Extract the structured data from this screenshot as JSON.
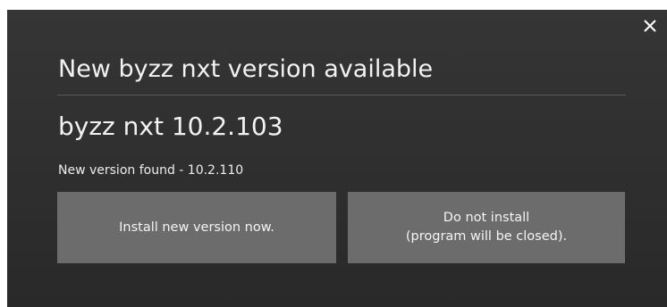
{
  "dialog": {
    "title": "New byzz nxt version available",
    "current_version": "byzz nxt 10.2.103",
    "found_text": "New version found - 10.2.110",
    "close_icon": "close-icon",
    "install_button": {
      "label": "Install new version now."
    },
    "cancel_button": {
      "line1": "Do not install",
      "line2": "(program will be closed)."
    }
  },
  "colors": {
    "background": "#2f2f2f",
    "button": "#6c6c6c",
    "text": "#f2f2f2"
  }
}
